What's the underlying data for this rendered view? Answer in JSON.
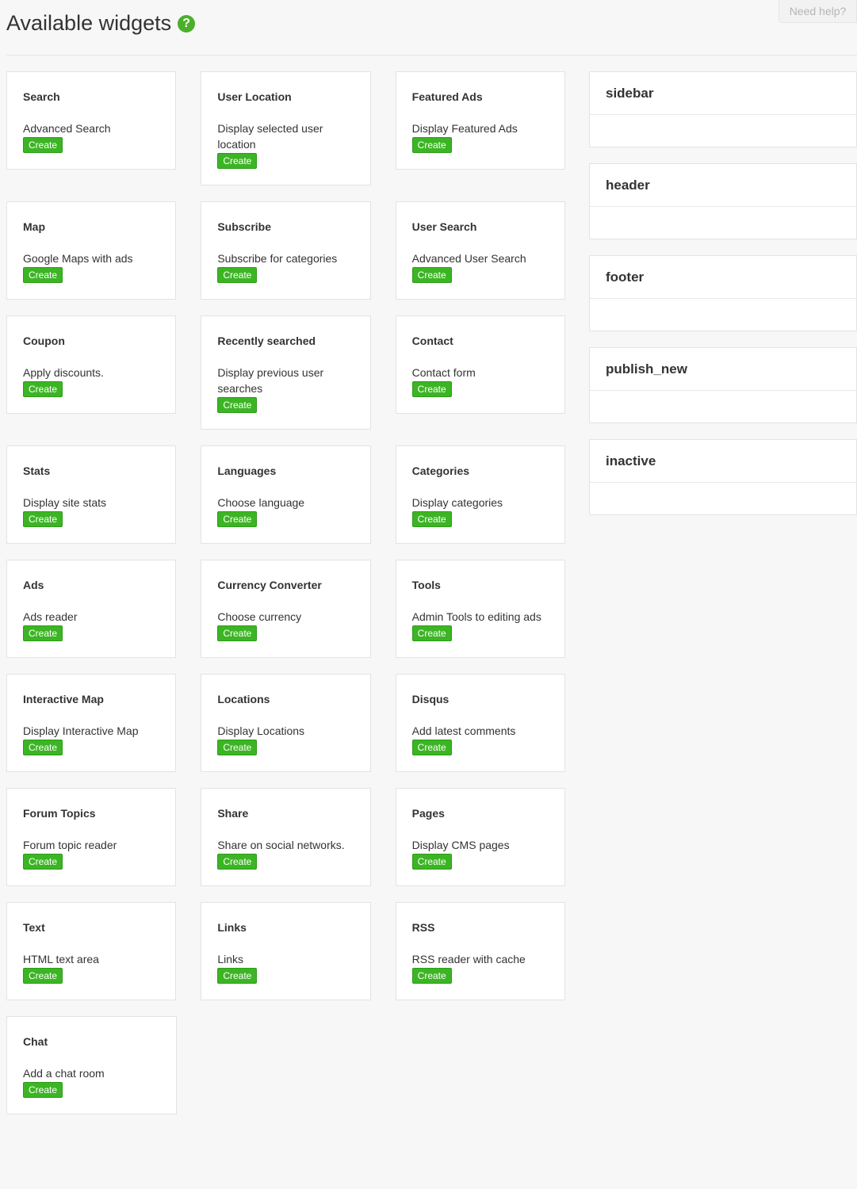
{
  "page": {
    "title": "Available widgets",
    "help_icon": "question-circle-icon",
    "need_help_label": "Need help?"
  },
  "colors": {
    "accent_green": "#3cb524",
    "help_icon_green": "#4caf2b"
  },
  "widgets": [
    {
      "title": "Search",
      "description": "Advanced Search",
      "button": "Create"
    },
    {
      "title": "User Location",
      "description": "Display selected user location",
      "button": "Create"
    },
    {
      "title": "Featured Ads",
      "description": "Display Featured Ads",
      "button": "Create"
    },
    {
      "title": "Map",
      "description": "Google Maps with ads",
      "button": "Create"
    },
    {
      "title": "Subscribe",
      "description": "Subscribe for categories",
      "button": "Create"
    },
    {
      "title": "User Search",
      "description": "Advanced User Search",
      "button": "Create"
    },
    {
      "title": "Coupon",
      "description": "Apply discounts.",
      "button": "Create"
    },
    {
      "title": "Recently searched",
      "description": "Display previous user searches",
      "button": "Create"
    },
    {
      "title": "Contact",
      "description": "Contact form",
      "button": "Create"
    },
    {
      "title": "Stats",
      "description": "Display site stats",
      "button": "Create"
    },
    {
      "title": "Languages",
      "description": "Choose language",
      "button": "Create"
    },
    {
      "title": "Categories",
      "description": "Display categories",
      "button": "Create"
    },
    {
      "title": "Ads",
      "description": "Ads reader",
      "button": "Create"
    },
    {
      "title": "Currency Converter",
      "description": "Choose currency",
      "button": "Create"
    },
    {
      "title": "Tools",
      "description": "Admin Tools to editing ads",
      "button": "Create"
    },
    {
      "title": "Interactive Map",
      "description": "Display Interactive Map",
      "button": "Create"
    },
    {
      "title": "Locations",
      "description": "Display Locations",
      "button": "Create"
    },
    {
      "title": "Disqus",
      "description": "Add latest comments",
      "button": "Create"
    },
    {
      "title": "Forum Topics",
      "description": "Forum topic reader",
      "button": "Create"
    },
    {
      "title": "Share",
      "description": "Share on social networks.",
      "button": "Create"
    },
    {
      "title": "Pages",
      "description": "Display CMS pages",
      "button": "Create"
    },
    {
      "title": "Text",
      "description": "HTML text area",
      "button": "Create"
    },
    {
      "title": "Links",
      "description": "Links",
      "button": "Create"
    },
    {
      "title": "RSS",
      "description": "RSS reader with cache",
      "button": "Create"
    },
    {
      "title": "Chat",
      "description": "Add a chat room",
      "button": "Create"
    }
  ],
  "zones": [
    {
      "name": "sidebar"
    },
    {
      "name": "header"
    },
    {
      "name": "footer"
    },
    {
      "name": "publish_new"
    },
    {
      "name": "inactive"
    }
  ]
}
